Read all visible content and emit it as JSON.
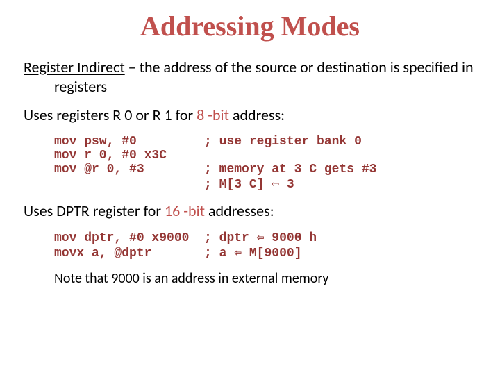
{
  "title": "Addressing Modes",
  "defn": {
    "mode": "Register Indirect",
    "dash": " – ",
    "rest": "the address of the source or destination is specified in registers"
  },
  "line8_a": "Uses registers R 0 or R 1 for ",
  "line8_b": "8 -bit",
  "line8_c": " address:",
  "code1": "mov psw, #0         ; use register bank 0\nmov r 0, #0 x3C\nmov @r 0, #3        ; memory at 3 C gets #3\n                    ; M[3 C] ⇦ 3",
  "line16_a": "Uses DPTR register for ",
  "line16_b": "16 -bit",
  "line16_c": " addresses:",
  "code2": "mov dptr, #0 x9000  ; dptr ⇦ 9000 h\nmovx a, @dptr       ; a ⇦ M[9000]",
  "note": "Note that 9000 is an address in external memory",
  "chart_data": null
}
